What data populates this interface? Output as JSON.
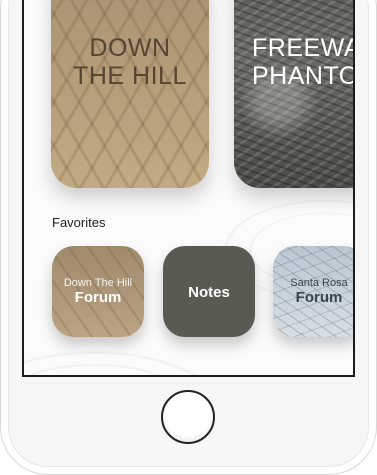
{
  "cards": [
    {
      "title_line1": "DOWN",
      "title_line2": "THE HILL"
    },
    {
      "title_line1": "FREEWA",
      "title_line2": "PHANTO"
    }
  ],
  "favorites": {
    "heading": "Favorites",
    "items": [
      {
        "subtitle": "Down The Hill",
        "label": "Forum"
      },
      {
        "subtitle": "",
        "label": "Notes"
      },
      {
        "subtitle": "Santa Rosa",
        "label": "Forum"
      }
    ]
  }
}
